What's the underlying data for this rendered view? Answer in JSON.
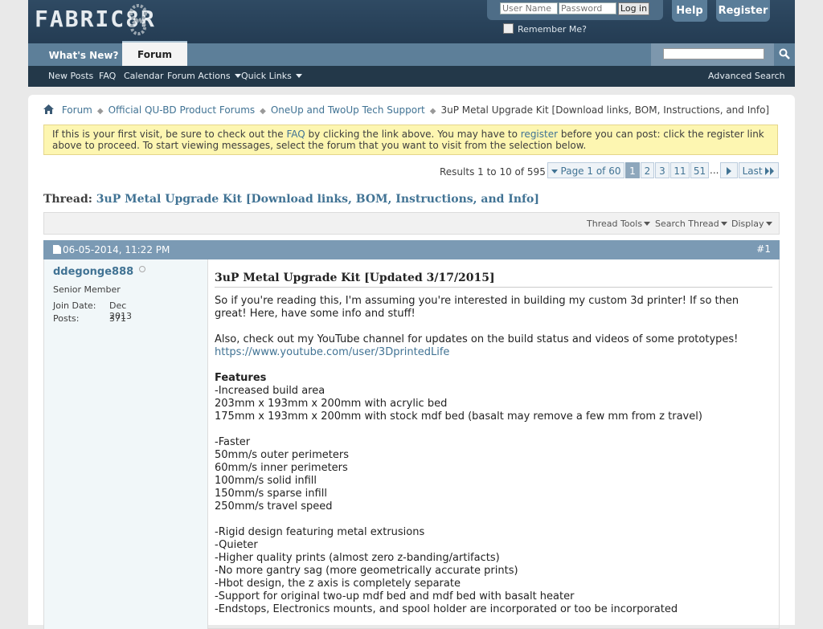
{
  "header": {
    "logo_text": "FABRIC8R",
    "login": {
      "username_placeholder": "User Name",
      "password_placeholder": "Password",
      "login_label": "Log in",
      "remember_label": "Remember Me?"
    },
    "help_label": "Help",
    "register_label": "Register"
  },
  "nav": {
    "whats_new": "What's New?",
    "forum": "Forum"
  },
  "subnav": {
    "new_posts": "New Posts",
    "faq": "FAQ",
    "calendar": "Calendar",
    "forum_actions": "Forum Actions",
    "quick_links": "Quick Links",
    "advanced_search": "Advanced Search"
  },
  "breadcrumb": {
    "items": [
      "Forum",
      "Official QU-BD Product Forums",
      "OneUp and TwoUp Tech Support"
    ],
    "current": "3uP Metal Upgrade Kit [Download links, BOM, Instructions, and Info]"
  },
  "notice": {
    "part1": "If this is your first visit, be sure to check out the ",
    "faq_link": "FAQ",
    "part2": " by clicking the link above. You may have to ",
    "register_link": "register",
    "part3": " before you can post: click the register link above to proceed. To start viewing messages, select the forum that you want to visit from the selection below."
  },
  "pagination": {
    "results": "Results 1 to 10 of 595",
    "page_of": "Page 1 of 60",
    "pages": [
      "1",
      "2",
      "3",
      "11",
      "51"
    ],
    "ellipsis": "...",
    "last": "Last"
  },
  "thread": {
    "prefix": "Thread: ",
    "title": "3uP Metal Upgrade Kit [Download links, BOM, Instructions, and Info]",
    "tools": [
      "Thread Tools",
      "Search Thread",
      "Display"
    ]
  },
  "post": {
    "date": "06-05-2014, 11:22 PM",
    "number": "#1",
    "user": {
      "name": "ddegonge888",
      "rank": "Senior Member",
      "join_label": "Join Date:",
      "join_value": "Dec 2013",
      "posts_label": "Posts:",
      "posts_value": "371"
    },
    "title": "3uP Metal Upgrade Kit [Updated 3/17/2015]",
    "lines": [
      "So if you're reading this, I'm assuming you're interested in building my custom 3d printer! If so then",
      "great! Here, have some info and stuff!",
      "",
      "Also, check out my YouTube channel for updates on the build status and videos of some prototypes!",
      "https://www.youtube.com/user/3DprintedLife",
      "",
      "Features",
      "-Increased build area",
      "203mm x 193mm x 200mm with acrylic bed",
      "175mm x 193mm x 200mm with stock mdf bed (basalt may remove a few mm from z travel)",
      "",
      "-Faster",
      "50mm/s outer perimeters",
      "60mm/s inner perimeters",
      "100mm/s solid infill",
      "150mm/s sparse infill",
      "250mm/s travel speed",
      "",
      "-Rigid design featuring metal extrusions",
      "-Quieter",
      "-Higher quality prints (almost zero z-banding/artifacts)",
      "-No more gantry sag (more geometrically accurate prints)",
      "-Hbot design, the z axis is completely separate",
      "-Support for original two-up mdf bed and mdf bed with basalt heater",
      "-Endstops, Electronics mounts, and spool holder are incorporated or too be incorporated"
    ]
  }
}
